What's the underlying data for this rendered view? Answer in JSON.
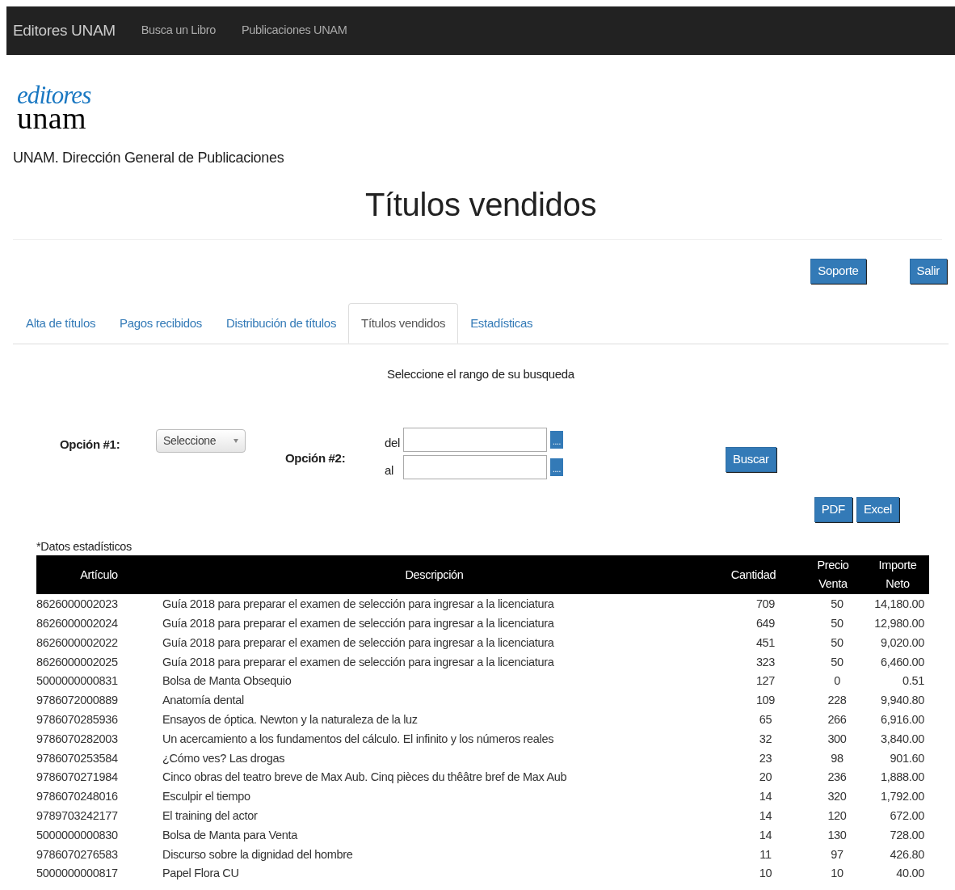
{
  "navbar": {
    "brand": "Editores UNAM",
    "links": [
      "Busca un Libro",
      "Publicaciones UNAM"
    ]
  },
  "logo": {
    "top": "editores",
    "bottom": "unam"
  },
  "subtitle": "UNAM. Dirección General de Publicaciones",
  "heading": "Títulos vendidos",
  "top_buttons": [
    "Soporte",
    "Salir"
  ],
  "tabs": [
    {
      "label": "Alta de títulos",
      "selected": false
    },
    {
      "label": "Pagos recibidos",
      "selected": false
    },
    {
      "label": "Distribución de títulos",
      "selected": false
    },
    {
      "label": "Títulos vendidos",
      "selected": true
    },
    {
      "label": "Estadísticas",
      "selected": false
    }
  ],
  "search": {
    "prompt": "Seleccione el rango de su busqueda",
    "option1_label": "Opción #1:",
    "option1_select": "Seleccione",
    "option2_label": "Opción #2:",
    "from_label": "del",
    "to_label": "al",
    "picker_button": "....",
    "search_button": "Buscar"
  },
  "export_buttons": [
    "PDF",
    "Excel"
  ],
  "table": {
    "caption": "*Datos estadísticos",
    "columns": [
      "Artículo",
      "Descripción",
      "Cantidad",
      "Precio Venta",
      "Importe Neto"
    ],
    "rows": [
      [
        "8626000002023",
        "Guía 2018 para preparar el examen de selección para ingresar a la licenciatura",
        "709",
        "50",
        "14,180.00"
      ],
      [
        "8626000002024",
        "Guía 2018 para preparar el examen de selección para ingresar a la licenciatura",
        "649",
        "50",
        "12,980.00"
      ],
      [
        "8626000002022",
        "Guía 2018 para preparar el examen de selección para ingresar a la licenciatura",
        "451",
        "50",
        "9,020.00"
      ],
      [
        "8626000002025",
        "Guía 2018 para preparar el examen de selección para ingresar a la licenciatura",
        "323",
        "50",
        "6,460.00"
      ],
      [
        "5000000000831",
        "Bolsa de Manta Obsequio",
        "127",
        "0",
        "0.51"
      ],
      [
        "9786072000889",
        "Anatomía dental",
        "109",
        "228",
        "9,940.80"
      ],
      [
        "9786070285936",
        "Ensayos de óptica. Newton y la naturaleza de la luz",
        "65",
        "266",
        "6,916.00"
      ],
      [
        "9786070282003",
        "Un acercamiento a los fundamentos del cálculo. El infinito y los números reales",
        "32",
        "300",
        "3,840.00"
      ],
      [
        "9786070253584",
        "¿Cómo ves? Las drogas",
        "23",
        "98",
        "901.60"
      ],
      [
        "9786070271984",
        "Cinco obras del teatro breve de Max Aub. Cinq pièces du thêâtre bref de Max Aub",
        "20",
        "236",
        "1,888.00"
      ],
      [
        "9786070248016",
        "Esculpir el tiempo",
        "14",
        "320",
        "1,792.00"
      ],
      [
        "9789703242177",
        "El training del actor",
        "14",
        "120",
        "672.00"
      ],
      [
        "5000000000830",
        "Bolsa de Manta para Venta",
        "14",
        "130",
        "728.00"
      ],
      [
        "9786070276583",
        "Discurso sobre la dignidad del hombre",
        "11",
        "97",
        "426.80"
      ],
      [
        "5000000000817",
        "Papel Flora CU",
        "10",
        "10",
        "40.00"
      ]
    ]
  }
}
